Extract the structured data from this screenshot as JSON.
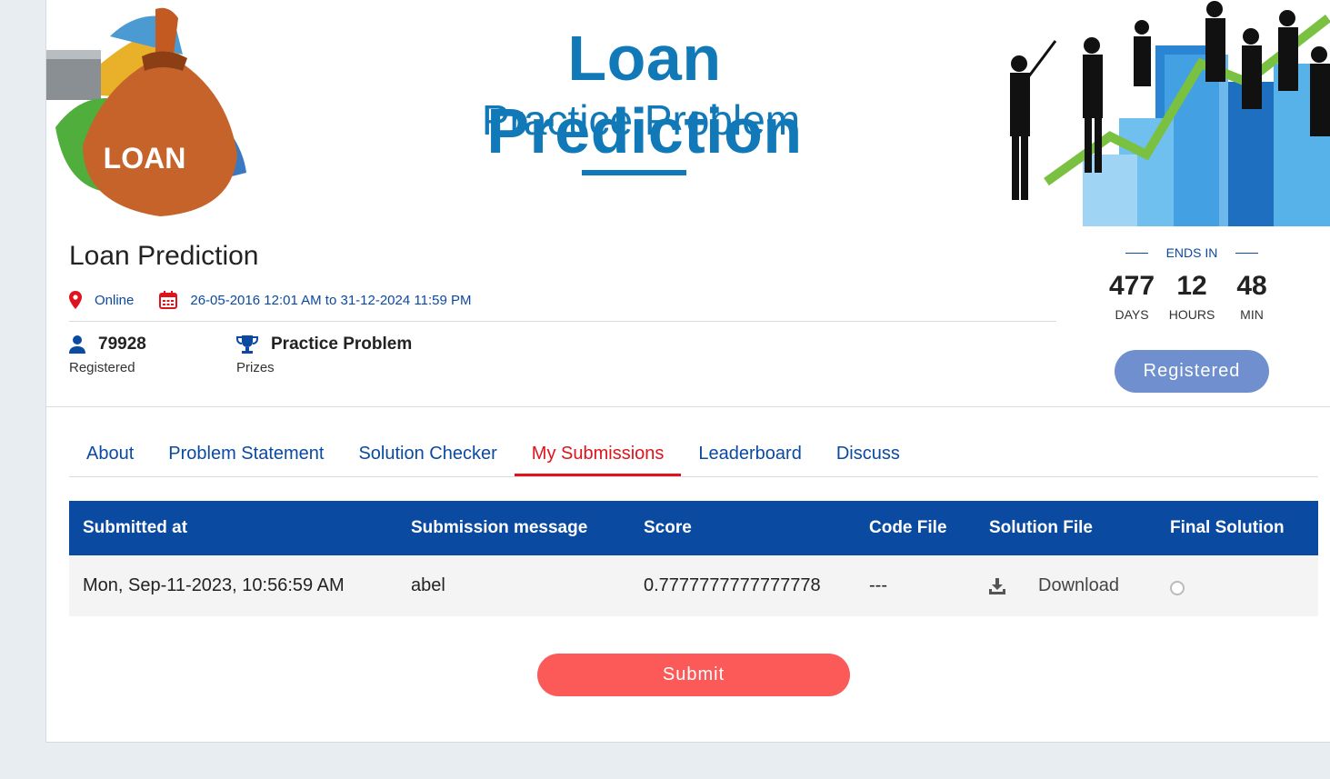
{
  "banner": {
    "title": "Loan Prediction",
    "subtitle": "Practice Problem",
    "bag_label": "LOAN"
  },
  "hackathon": {
    "title": "Loan Prediction",
    "mode": "Online",
    "dates": "26-05-2016 12:01 AM to 31-12-2024 11:59 PM",
    "registered_count": "79928",
    "registered_label": "Registered",
    "prize_value": "Practice Problem",
    "prize_label": "Prizes"
  },
  "timer": {
    "heading": "ENDS IN",
    "days": "477",
    "days_label": "DAYS",
    "hours": "12",
    "hours_label": "HOURS",
    "min": "48",
    "min_label": "MIN",
    "button": "Registered"
  },
  "tabs": [
    {
      "label": "About"
    },
    {
      "label": "Problem Statement"
    },
    {
      "label": "Solution Checker"
    },
    {
      "label": "My Submissions",
      "active": true
    },
    {
      "label": "Leaderboard"
    },
    {
      "label": "Discuss"
    }
  ],
  "table": {
    "headers": [
      "Submitted at",
      "Submission message",
      "Score",
      "Code File",
      "Solution File",
      "Final Solution"
    ],
    "rows": [
      {
        "submitted_at": "Mon, Sep-11-2023, 10:56:59 AM",
        "message": "abel",
        "score": "0.7777777777777778",
        "code_file": "---",
        "solution_file": "Download",
        "final_solution": false
      }
    ]
  },
  "submit_button": "Submit",
  "colors": {
    "primary": "#0b4aa1",
    "active_tab": "#e0131c",
    "submit": "#fc5959",
    "registered_btn": "#6f8fcf",
    "banner_text": "#1279b8"
  }
}
